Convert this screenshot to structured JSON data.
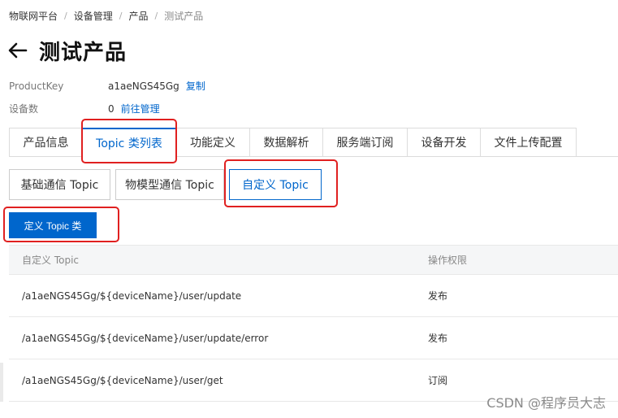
{
  "breadcrumb": [
    "物联网平台",
    "设备管理",
    "产品",
    "测试产品"
  ],
  "page_title": "测试产品",
  "meta": [
    {
      "label": "ProductKey",
      "value": "a1aeNGS45Gg",
      "link": "复制"
    },
    {
      "label": "设备数",
      "value": "0",
      "link": "前往管理"
    }
  ],
  "tabs": [
    "产品信息",
    "Topic 类列表",
    "功能定义",
    "数据解析",
    "服务端订阅",
    "设备开发",
    "文件上传配置"
  ],
  "active_tab": "Topic 类列表",
  "subtabs": [
    "基础通信 Topic",
    "物模型通信 Topic",
    "自定义 Topic"
  ],
  "active_subtab": "自定义 Topic",
  "define_button": "定义 Topic 类",
  "table": {
    "headers": [
      "自定义 Topic",
      "操作权限"
    ],
    "rows": [
      [
        "/a1aeNGS45Gg/${deviceName}/user/update",
        "发布"
      ],
      [
        "/a1aeNGS45Gg/${deviceName}/user/update/error",
        "发布"
      ],
      [
        "/a1aeNGS45Gg/${deviceName}/user/get",
        "订阅"
      ]
    ]
  },
  "watermark": "CSDN @程序员大志",
  "colors": {
    "accent": "#0066cc",
    "highlight": "#e02020"
  }
}
